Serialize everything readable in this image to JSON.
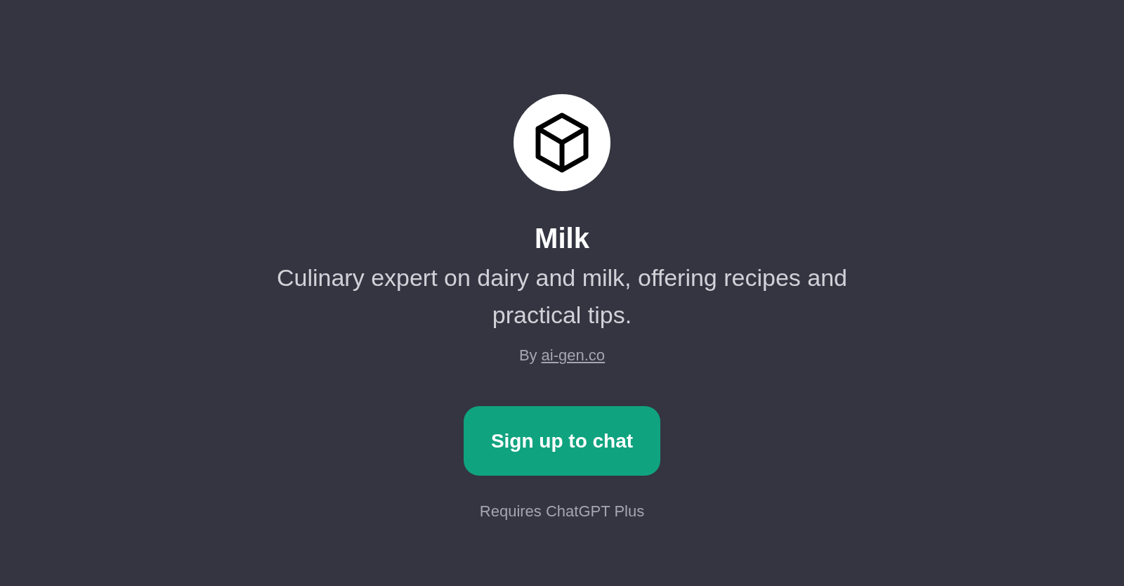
{
  "gpt": {
    "name": "Milk",
    "description": "Culinary expert on dairy and milk, offering recipes and practical tips.",
    "author_prefix": "By",
    "author_link": "ai-gen.co"
  },
  "cta": {
    "label": "Sign up to chat"
  },
  "note": "Requires ChatGPT Plus"
}
